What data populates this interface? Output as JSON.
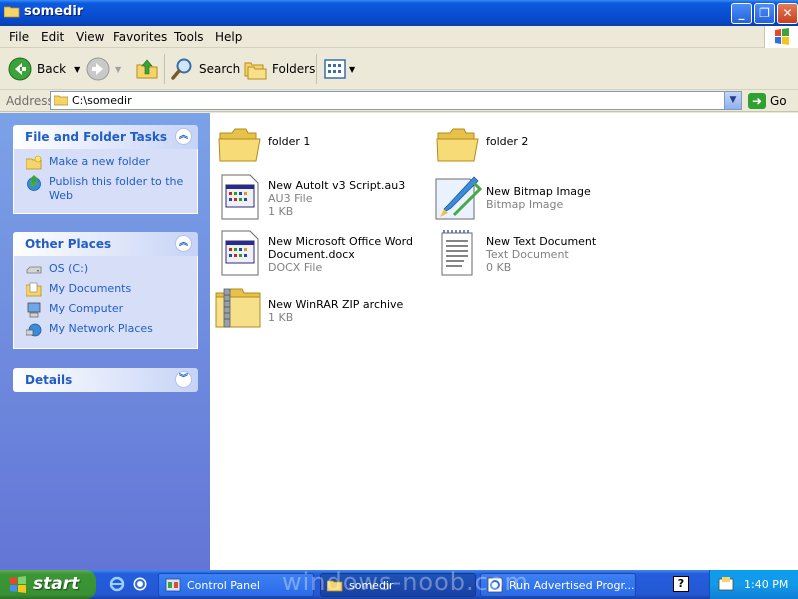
{
  "window": {
    "title": "somedir",
    "buttons": {
      "minimize": "_",
      "maximize": "❐",
      "close": "✕"
    }
  },
  "menu": [
    "File",
    "Edit",
    "View",
    "Favorites",
    "Tools",
    "Help"
  ],
  "toolbar": {
    "back_label": "Back",
    "search_label": "Search",
    "folders_label": "Folders"
  },
  "address": {
    "label": "Address",
    "value": "C:\\somedir",
    "go_label": "Go"
  },
  "taskpane": {
    "tasks": {
      "title": "File and Folder Tasks",
      "items": [
        {
          "label": "Make a new folder",
          "icon": "new-folder-icon"
        },
        {
          "label": "Publish this folder to the Web",
          "icon": "publish-web-icon"
        }
      ]
    },
    "places": {
      "title": "Other Places",
      "items": [
        {
          "label": "OS (C:)",
          "icon": "drive-icon"
        },
        {
          "label": "My Documents",
          "icon": "my-documents-icon"
        },
        {
          "label": "My Computer",
          "icon": "my-computer-icon"
        },
        {
          "label": "My Network Places",
          "icon": "network-places-icon"
        }
      ]
    },
    "details": {
      "title": "Details"
    }
  },
  "files": [
    {
      "name": "folder 1",
      "type": "",
      "size": "",
      "icon": "folder-icon"
    },
    {
      "name": "folder 2",
      "type": "",
      "size": "",
      "icon": "folder-icon"
    },
    {
      "name": "New AutoIt v3 Script.au3",
      "type": "AU3 File",
      "size": "1 KB",
      "icon": "generic-file-icon"
    },
    {
      "name": "New Bitmap Image",
      "type": "Bitmap Image",
      "size": "",
      "icon": "bitmap-icon"
    },
    {
      "name": "New Microsoft Office Word Document.docx",
      "type": "DOCX File",
      "size": "",
      "icon": "generic-file-icon"
    },
    {
      "name": "New Text Document",
      "type": "Text Document",
      "size": "0 KB",
      "icon": "text-document-icon"
    },
    {
      "name": "New WinRAR ZIP archive",
      "type": "",
      "size": "1 KB",
      "icon": "zip-folder-icon"
    }
  ],
  "taskbar": {
    "start_label": "start",
    "tasks": [
      {
        "label": "Control Panel",
        "active": false
      },
      {
        "label": "somedir",
        "active": true
      },
      {
        "label": "Run Advertised Progr...",
        "active": false
      }
    ],
    "clock": "1:40 PM"
  },
  "watermark": "windows-noob.com",
  "colors": {
    "titlebar": "#0A4FD4",
    "taskpane_link": "#215DC6",
    "start_green": "#3C9636"
  }
}
